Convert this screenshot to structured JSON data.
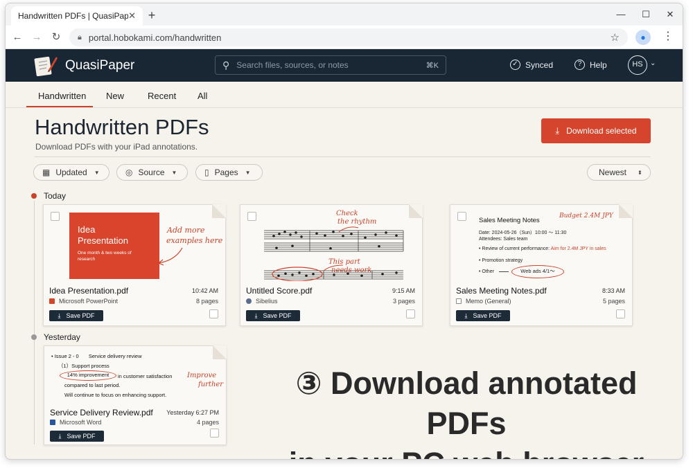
{
  "browser": {
    "tab_title": "Handwritten PDFs | QuasiPaper",
    "url": "portal.hobokami.com/handwritten"
  },
  "app": {
    "brand": "QuasiPaper",
    "search_placeholder": "Search files, sources, or notes",
    "search_shortcut": "⌘K",
    "synced": "Synced",
    "help": "Help",
    "avatar": "HS"
  },
  "nav": {
    "tabs": [
      {
        "label": "Handwritten"
      },
      {
        "label": "New"
      },
      {
        "label": "Recent"
      },
      {
        "label": "All"
      }
    ]
  },
  "page": {
    "title": "Handwritten PDFs",
    "subtitle": "Download PDFs with your iPad annotations.",
    "download_selected": "Download selected"
  },
  "filters": {
    "updated": "Updated",
    "source": "Source",
    "pages": "Pages",
    "sort": "Newest"
  },
  "sections": {
    "today": "Today",
    "yesterday": "Yesterday"
  },
  "cards": [
    {
      "filename": "Idea Presentation.pdf",
      "time": "10:42 AM",
      "source": "Microsoft PowerPoint",
      "pages": "8 pages",
      "save": "Save PDF",
      "thumb": {
        "slide_title_1": "Idea",
        "slide_title_2": "Presentation",
        "slide_sub_1": "One month & two weeks of",
        "slide_sub_2": "research",
        "note_1": "Add more",
        "note_2": "examples here"
      }
    },
    {
      "filename": "Untitled Score.pdf",
      "time": "9:15 AM",
      "source": "Sibelius",
      "pages": "3 pages",
      "save": "Save PDF",
      "thumb": {
        "note_1a": "Check",
        "note_1b": "the rhythm",
        "note_2a": "This part",
        "note_2b": "needs work"
      }
    },
    {
      "filename": "Sales Meeting Notes.pdf",
      "time": "8:33 AM",
      "source": "Memo (General)",
      "pages": "5 pages",
      "save": "Save PDF",
      "thumb": {
        "heading": "Sales Meeting Notes",
        "budget": "Budget 2.4M JPY",
        "date": "Date:  2024-05-26（Sun）10:00 ～ 11:30",
        "attendees": "Attendees:  Sales team",
        "bullet_1": "Review of current performance:",
        "bullet_1_note": "Aim for 2.4M JPY in sales",
        "bullet_2": "Promotion strategy",
        "bullet_3": "Other",
        "bullet_3_circled": "Web ads 4/1～"
      }
    },
    {
      "filename": "Service Delivery Review.pdf",
      "time": "Yesterday 6:27 PM",
      "source": "Microsoft Word",
      "pages": "4 pages",
      "save": "Save PDF",
      "thumb": {
        "line_1a": "• Issue 2 - 0",
        "line_1b": "Service delivery review",
        "line_2": "（1）Support process",
        "circled": "14% improvement",
        "line_3": "in customer satisfaction",
        "line_4": "compared to last period.",
        "line_5": "Will continue to focus on enhancing support.",
        "note_1": "Improve",
        "note_2": "further"
      }
    }
  ],
  "tagline": {
    "line_1": "③ Download annotated PDFs",
    "line_2": "in your PC web browser"
  },
  "colors": {
    "accent": "#d5452d",
    "header_bg": "#192735",
    "page_bg": "#f6f2ec"
  }
}
